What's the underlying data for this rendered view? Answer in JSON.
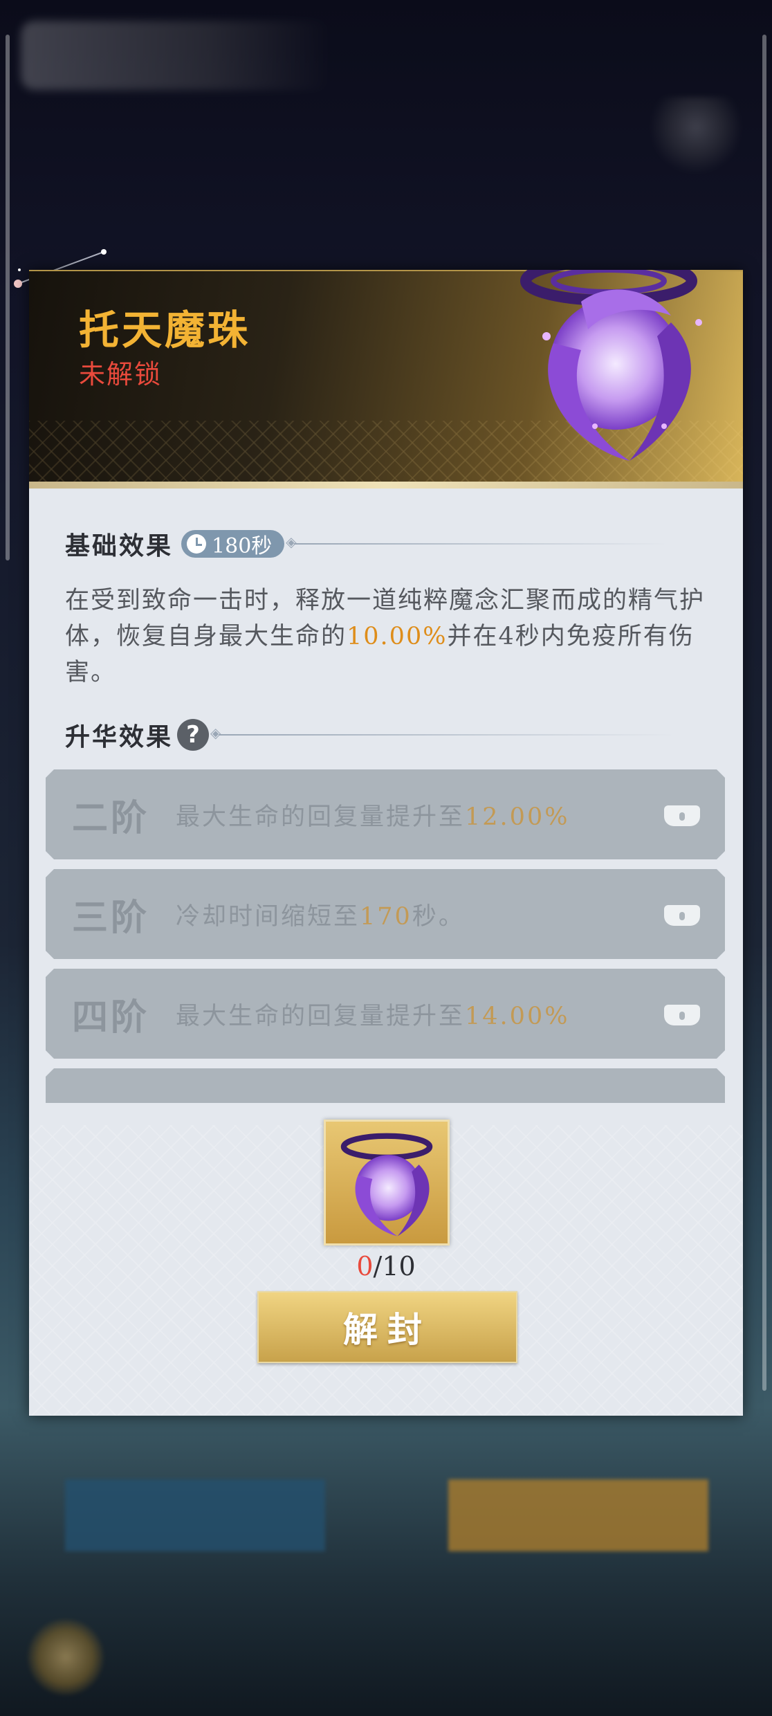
{
  "panel": {
    "title": "托天魔珠",
    "status": "未解锁",
    "base_effect": {
      "heading": "基础效果",
      "cooldown": "180秒",
      "desc_parts": [
        "在受到致命一击时，释放一道纯粹魔念汇聚而成的精气护体，恢复自身最大生命的",
        "10.00%",
        "并在4秒内免疫所有伤害。"
      ]
    },
    "ascension": {
      "heading": "升华效果",
      "help_icon": "?",
      "tiers": [
        {
          "name": "二阶",
          "text": "最大生命的回复量提升至",
          "value": "12.00%",
          "suffix": "",
          "locked": true
        },
        {
          "name": "三阶",
          "text": "冷却时间缩短至",
          "value": "170",
          "suffix": "秒。",
          "locked": true
        },
        {
          "name": "四阶",
          "text": "最大生命的回复量提升至",
          "value": "14.00%",
          "suffix": "",
          "locked": true
        }
      ]
    },
    "material": {
      "owned": "0",
      "required": "/10"
    },
    "unseal_label": "解封"
  },
  "colors": {
    "title": "#f3b334",
    "status": "#e94a3c",
    "highlight": "#de8d1a",
    "button": "#d9b35d"
  }
}
